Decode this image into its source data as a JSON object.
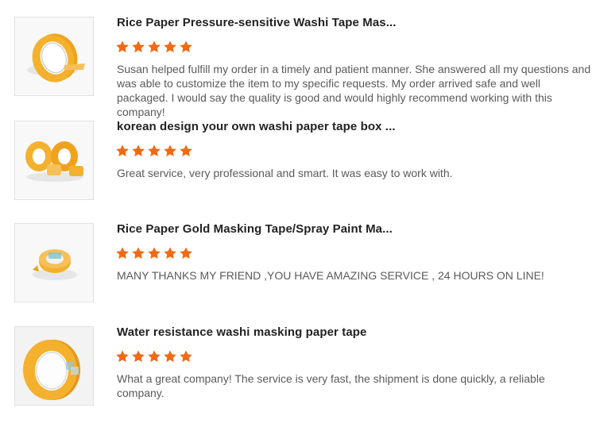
{
  "reviews": [
    {
      "title": "Rice Paper Pressure-sensitive Washi Tape Mas...",
      "rating": 5,
      "comment": "Susan helped fulfill my order in a timely and patient manner. She answered all my questions and was able to customize the item to my specific requests. My order arrived safe and well packaged. I would say the quality is good and would highly recommend working with this company!"
    },
    {
      "title": "korean design your own washi paper tape box ...",
      "rating": 5,
      "comment": "Great service, very professional and smart. It was easy to work with."
    },
    {
      "title": "Rice Paper Gold Masking Tape/Spray Paint Ma...",
      "rating": 5,
      "comment": "MANY THANKS MY FRIEND ,YOU HAVE AMAZING SERVICE , 24 HOURS ON LINE!"
    },
    {
      "title": "Water resistance washi masking paper tape",
      "rating": 5,
      "comment": "What a great company! The service is very fast, the shipment is done quickly, a reliable company."
    }
  ],
  "colors": {
    "star": "#f06a16",
    "tape": "#f4b12e",
    "tape_dark": "#d88d12"
  },
  "icons": {
    "star": "star-icon"
  }
}
